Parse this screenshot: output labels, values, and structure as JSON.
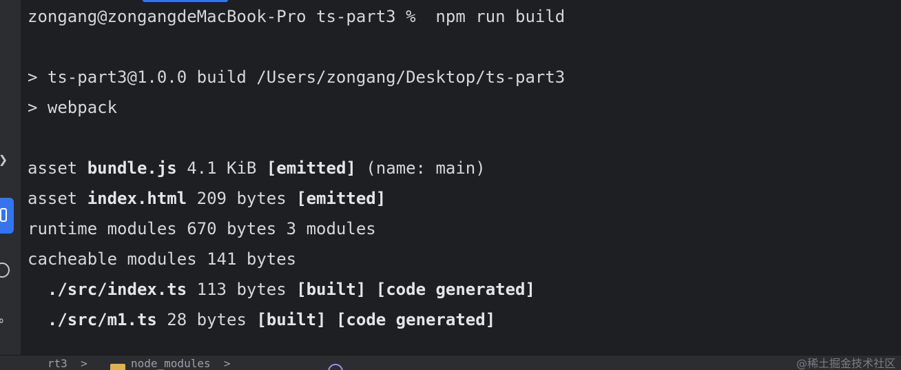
{
  "terminal": {
    "prompt_line": "zongang@zongangdeMacBook-Pro ts-part3 %  npm run build",
    "script_line": "> ts-part3@1.0.0 build /Users/zongang/Desktop/ts-part3",
    "cmd_line": "> webpack",
    "asset1": {
      "prefix": "asset ",
      "name": "bundle.js",
      "size": " 4.1 KiB ",
      "tag": "[emitted]",
      "suffix": " (name: main)"
    },
    "asset2": {
      "prefix": "asset ",
      "name": "index.html",
      "size": " 209 bytes ",
      "tag": "[emitted]"
    },
    "runtime_line": "runtime modules 670 bytes 3 modules",
    "cacheable_line": "cacheable modules 141 bytes",
    "module1": {
      "path": "./src/index.ts",
      "size": " 113 bytes ",
      "tag1": "[built]",
      "tag2": "[code generated]"
    },
    "module2": {
      "path": "./src/m1.ts",
      "size": " 28 bytes ",
      "tag1": "[built]",
      "tag2": "[code generated]"
    }
  },
  "statusbar": {
    "crumb_left": "   rt3  >",
    "crumb_mid": "node_modules  >  ",
    "crumb_right": "   "
  },
  "watermark": "@稀土掘金技术社区",
  "icons": {
    "chevron": "chevron-right-icon",
    "terminal": "terminal-icon",
    "circle": "problems-icon",
    "link": "vcs-icon",
    "folder": "folder-icon",
    "module": "module-icon"
  }
}
